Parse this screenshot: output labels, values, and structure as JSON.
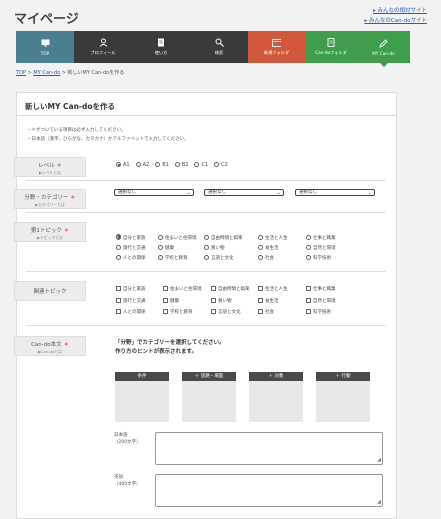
{
  "page_title": "マイページ",
  "ext_links": [
    "▸ みんなの相対サイト",
    "▸ みんなのCan-doサイト"
  ],
  "nav": {
    "items": [
      {
        "label": "TOP",
        "color": "#4b7f8f"
      },
      {
        "label": "プロフィール",
        "color": "#3a3a3a"
      },
      {
        "label": "使い方",
        "color": "#3a3a3a"
      },
      {
        "label": "検索",
        "color": "#3a3a3a"
      },
      {
        "label": "新規フォルダ",
        "color": "#d0573a"
      },
      {
        "label": "Can-doフォルダ",
        "color": "#3e9e4d"
      },
      {
        "label": "MY Can-do",
        "color": "#3e9e4d"
      }
    ]
  },
  "breadcrumb": {
    "top": "TOP",
    "sep": ">",
    "mycando": "MY Can-do",
    "current": "新しいMY Can-doを作る"
  },
  "form": {
    "heading": "新しいMY Can-doを作る",
    "note1": "＊がついている項目は必ず入力してください。",
    "note2": "日本語（漢字、ひらがな、カタカナ）かアルファベットで入力してください。",
    "level": {
      "label": "レベル",
      "sub": "▶レベルとは",
      "options": [
        "A1",
        "A2",
        "B1",
        "B2",
        "C1",
        "C2"
      ]
    },
    "category": {
      "label": "分野・カテゴリー",
      "sub": "▶カテゴリーとは",
      "select_value": "選択なし"
    },
    "topic1": {
      "label": "第1トピック",
      "sub": "▶トピックとは",
      "options": [
        "自分と家族",
        "住まいと住環境",
        "自由時間と娯楽",
        "生活と人生",
        "仕事と職業",
        "旅行と交通",
        "健康",
        "買い物",
        "食生活",
        "自然と環境",
        "人との関係",
        "学校と教育",
        "言語と文化",
        "社会",
        "科学技術"
      ]
    },
    "topic2": {
      "label": "関連トピック",
      "options": [
        "自分と家族",
        "住まいと住環境",
        "自由時間と娯楽",
        "生活と人生",
        "仕事と職業",
        "旅行と交通",
        "健康",
        "買い物",
        "食生活",
        "自然と環境",
        "人との関係",
        "学校と教育",
        "言語と文化",
        "社会",
        "科学技術"
      ]
    },
    "cando": {
      "label": "Can-do本文",
      "sub": "▶Can-doとは",
      "instr1": "「分野」でカテゴリーを選択してください。",
      "instr2": "作り方のヒントが表示されます。",
      "boxes": [
        "条件",
        "＋ 話題・場面",
        "＋ 対象",
        "＋ 行動"
      ]
    },
    "jp": {
      "label": "日本語",
      "limit": "（200文字）"
    },
    "en": {
      "label": "英語",
      "limit": "（400文字）"
    }
  }
}
